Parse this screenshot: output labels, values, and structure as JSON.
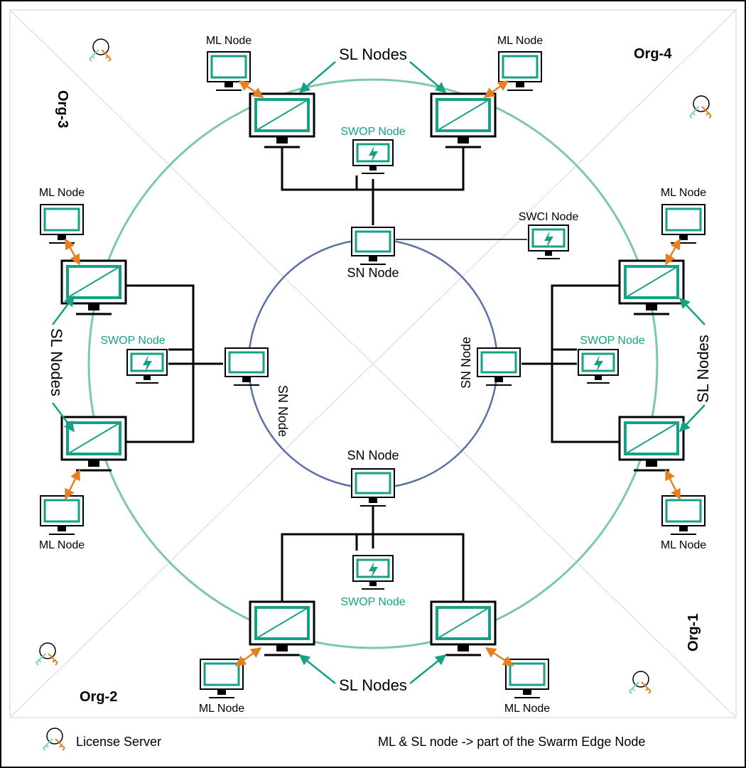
{
  "diagram": {
    "title_sl_nodes": "SL Nodes",
    "sn_node": "SN Node",
    "swop_node": "SWOP  Node",
    "swci_node": "SWCI  Node",
    "ml_node": "ML Node",
    "orgs": {
      "o1": "Org-1",
      "o2": "Org-2",
      "o3": "Org-3",
      "o4": "Org-4"
    },
    "legend": {
      "license_server": "License Server",
      "note": "ML & SL node -> part of the Swarm Edge Node"
    },
    "colors": {
      "green": "#16a085",
      "blue": "#5b6fa8",
      "orange": "#e67e22",
      "gray": "#e8e8e8"
    }
  }
}
